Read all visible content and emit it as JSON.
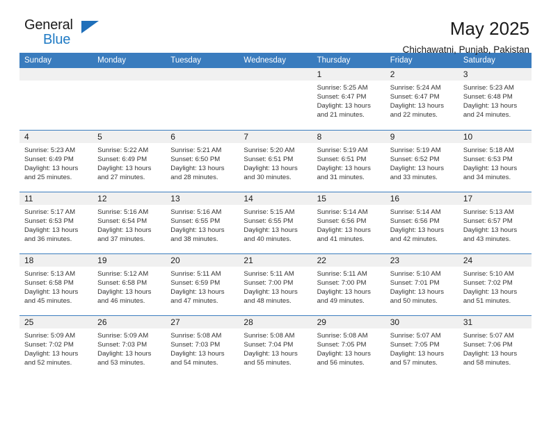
{
  "brand": {
    "name_part1": "General",
    "name_part2": "Blue",
    "accent_color": "#1f7ac4",
    "triangle_icon": "triangle-icon"
  },
  "header": {
    "title": "May 2025",
    "subtitle": "Chichawatni, Punjab, Pakistan"
  },
  "calendar": {
    "header_bg": "#3a7cbe",
    "daynum_bg": "#f0f0f0",
    "columns": [
      "Sunday",
      "Monday",
      "Tuesday",
      "Wednesday",
      "Thursday",
      "Friday",
      "Saturday"
    ],
    "weeks": [
      [
        {
          "day": "",
          "empty": true
        },
        {
          "day": "",
          "empty": true
        },
        {
          "day": "",
          "empty": true
        },
        {
          "day": "",
          "empty": true
        },
        {
          "day": "1",
          "sunrise": "Sunrise: 5:25 AM",
          "sunset": "Sunset: 6:47 PM",
          "daylight": "Daylight: 13 hours and 21 minutes."
        },
        {
          "day": "2",
          "sunrise": "Sunrise: 5:24 AM",
          "sunset": "Sunset: 6:47 PM",
          "daylight": "Daylight: 13 hours and 22 minutes."
        },
        {
          "day": "3",
          "sunrise": "Sunrise: 5:23 AM",
          "sunset": "Sunset: 6:48 PM",
          "daylight": "Daylight: 13 hours and 24 minutes."
        }
      ],
      [
        {
          "day": "4",
          "sunrise": "Sunrise: 5:23 AM",
          "sunset": "Sunset: 6:49 PM",
          "daylight": "Daylight: 13 hours and 25 minutes."
        },
        {
          "day": "5",
          "sunrise": "Sunrise: 5:22 AM",
          "sunset": "Sunset: 6:49 PM",
          "daylight": "Daylight: 13 hours and 27 minutes."
        },
        {
          "day": "6",
          "sunrise": "Sunrise: 5:21 AM",
          "sunset": "Sunset: 6:50 PM",
          "daylight": "Daylight: 13 hours and 28 minutes."
        },
        {
          "day": "7",
          "sunrise": "Sunrise: 5:20 AM",
          "sunset": "Sunset: 6:51 PM",
          "daylight": "Daylight: 13 hours and 30 minutes."
        },
        {
          "day": "8",
          "sunrise": "Sunrise: 5:19 AM",
          "sunset": "Sunset: 6:51 PM",
          "daylight": "Daylight: 13 hours and 31 minutes."
        },
        {
          "day": "9",
          "sunrise": "Sunrise: 5:19 AM",
          "sunset": "Sunset: 6:52 PM",
          "daylight": "Daylight: 13 hours and 33 minutes."
        },
        {
          "day": "10",
          "sunrise": "Sunrise: 5:18 AM",
          "sunset": "Sunset: 6:53 PM",
          "daylight": "Daylight: 13 hours and 34 minutes."
        }
      ],
      [
        {
          "day": "11",
          "sunrise": "Sunrise: 5:17 AM",
          "sunset": "Sunset: 6:53 PM",
          "daylight": "Daylight: 13 hours and 36 minutes."
        },
        {
          "day": "12",
          "sunrise": "Sunrise: 5:16 AM",
          "sunset": "Sunset: 6:54 PM",
          "daylight": "Daylight: 13 hours and 37 minutes."
        },
        {
          "day": "13",
          "sunrise": "Sunrise: 5:16 AM",
          "sunset": "Sunset: 6:55 PM",
          "daylight": "Daylight: 13 hours and 38 minutes."
        },
        {
          "day": "14",
          "sunrise": "Sunrise: 5:15 AM",
          "sunset": "Sunset: 6:55 PM",
          "daylight": "Daylight: 13 hours and 40 minutes."
        },
        {
          "day": "15",
          "sunrise": "Sunrise: 5:14 AM",
          "sunset": "Sunset: 6:56 PM",
          "daylight": "Daylight: 13 hours and 41 minutes."
        },
        {
          "day": "16",
          "sunrise": "Sunrise: 5:14 AM",
          "sunset": "Sunset: 6:56 PM",
          "daylight": "Daylight: 13 hours and 42 minutes."
        },
        {
          "day": "17",
          "sunrise": "Sunrise: 5:13 AM",
          "sunset": "Sunset: 6:57 PM",
          "daylight": "Daylight: 13 hours and 43 minutes."
        }
      ],
      [
        {
          "day": "18",
          "sunrise": "Sunrise: 5:13 AM",
          "sunset": "Sunset: 6:58 PM",
          "daylight": "Daylight: 13 hours and 45 minutes."
        },
        {
          "day": "19",
          "sunrise": "Sunrise: 5:12 AM",
          "sunset": "Sunset: 6:58 PM",
          "daylight": "Daylight: 13 hours and 46 minutes."
        },
        {
          "day": "20",
          "sunrise": "Sunrise: 5:11 AM",
          "sunset": "Sunset: 6:59 PM",
          "daylight": "Daylight: 13 hours and 47 minutes."
        },
        {
          "day": "21",
          "sunrise": "Sunrise: 5:11 AM",
          "sunset": "Sunset: 7:00 PM",
          "daylight": "Daylight: 13 hours and 48 minutes."
        },
        {
          "day": "22",
          "sunrise": "Sunrise: 5:11 AM",
          "sunset": "Sunset: 7:00 PM",
          "daylight": "Daylight: 13 hours and 49 minutes."
        },
        {
          "day": "23",
          "sunrise": "Sunrise: 5:10 AM",
          "sunset": "Sunset: 7:01 PM",
          "daylight": "Daylight: 13 hours and 50 minutes."
        },
        {
          "day": "24",
          "sunrise": "Sunrise: 5:10 AM",
          "sunset": "Sunset: 7:02 PM",
          "daylight": "Daylight: 13 hours and 51 minutes."
        }
      ],
      [
        {
          "day": "25",
          "sunrise": "Sunrise: 5:09 AM",
          "sunset": "Sunset: 7:02 PM",
          "daylight": "Daylight: 13 hours and 52 minutes."
        },
        {
          "day": "26",
          "sunrise": "Sunrise: 5:09 AM",
          "sunset": "Sunset: 7:03 PM",
          "daylight": "Daylight: 13 hours and 53 minutes."
        },
        {
          "day": "27",
          "sunrise": "Sunrise: 5:08 AM",
          "sunset": "Sunset: 7:03 PM",
          "daylight": "Daylight: 13 hours and 54 minutes."
        },
        {
          "day": "28",
          "sunrise": "Sunrise: 5:08 AM",
          "sunset": "Sunset: 7:04 PM",
          "daylight": "Daylight: 13 hours and 55 minutes."
        },
        {
          "day": "29",
          "sunrise": "Sunrise: 5:08 AM",
          "sunset": "Sunset: 7:05 PM",
          "daylight": "Daylight: 13 hours and 56 minutes."
        },
        {
          "day": "30",
          "sunrise": "Sunrise: 5:07 AM",
          "sunset": "Sunset: 7:05 PM",
          "daylight": "Daylight: 13 hours and 57 minutes."
        },
        {
          "day": "31",
          "sunrise": "Sunrise: 5:07 AM",
          "sunset": "Sunset: 7:06 PM",
          "daylight": "Daylight: 13 hours and 58 minutes."
        }
      ]
    ]
  }
}
